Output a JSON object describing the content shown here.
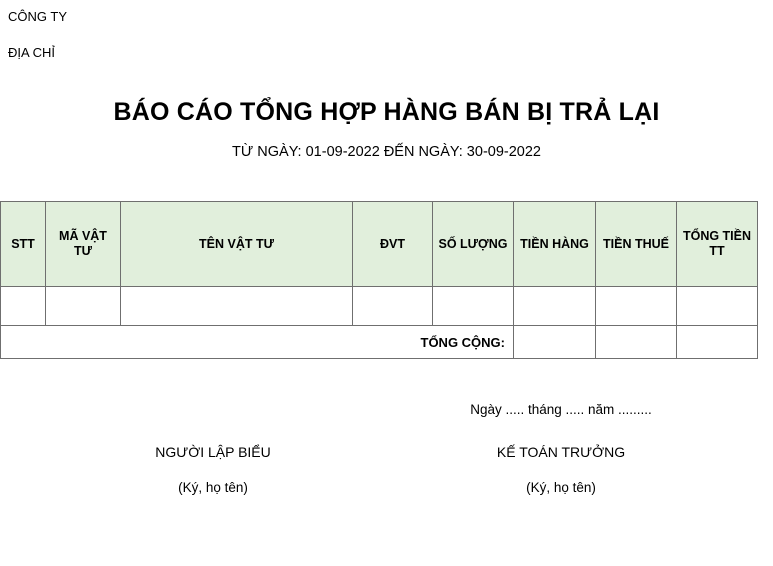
{
  "header": {
    "company_label": "CÔNG TY",
    "address_label": "ĐỊA CHỈ"
  },
  "title": {
    "main": "BÁO CÁO TỔNG HỢP HÀNG BÁN BỊ TRẢ LẠI",
    "period": "TỪ NGÀY: 01-09-2022 ĐẾN NGÀY: 30-09-2022"
  },
  "table": {
    "columns": [
      {
        "key": "stt",
        "label": "STT"
      },
      {
        "key": "ma_vat_tu",
        "label": "MÃ VẬT TƯ"
      },
      {
        "key": "ten_vat_tu",
        "label": "TÊN VẬT TƯ"
      },
      {
        "key": "dvt",
        "label": "ĐVT"
      },
      {
        "key": "so_luong",
        "label": "SỐ LƯỢNG"
      },
      {
        "key": "tien_hang",
        "label": "TIỀN HÀNG"
      },
      {
        "key": "tien_thue",
        "label": "TIỀN THUẾ"
      },
      {
        "key": "tong_tien",
        "label": "TỔNG TIỀN TT"
      }
    ],
    "rows": [
      {
        "stt": "",
        "ma_vat_tu": "",
        "ten_vat_tu": "",
        "dvt": "",
        "so_luong": "",
        "tien_hang": "",
        "tien_thue": "",
        "tong_tien": ""
      }
    ],
    "total_row": {
      "label": "TỔNG CỘNG:",
      "tien_hang": "",
      "tien_thue": "",
      "tong_tien": ""
    },
    "header_background": "#e1efdc",
    "border_color": "#6f6f6f"
  },
  "signatures": {
    "date_line": "Ngày ..... tháng ..... năm .........",
    "left": {
      "role": "NGƯỜI LẬP BIỂU",
      "note": "(Ký, họ tên)"
    },
    "right": {
      "role": "KẾ TOÁN TRƯỞNG",
      "note": "(Ký, họ tên)"
    }
  }
}
